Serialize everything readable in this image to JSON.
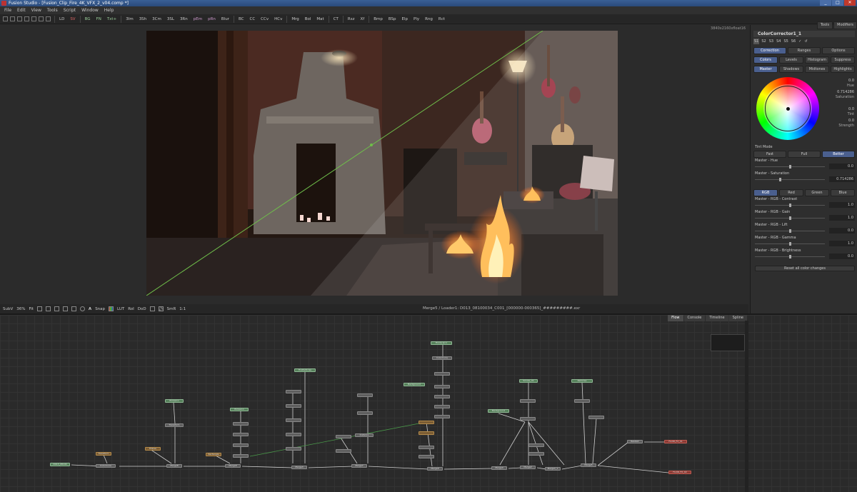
{
  "window": {
    "title": "Fusion Studio - [Fusion_Clip_Fire_4K_VFX_2_v04.comp *]",
    "controls": [
      "_",
      "□",
      "✕"
    ]
  },
  "menu": [
    "File",
    "Edit",
    "View",
    "Tools",
    "Script",
    "Window",
    "Help"
  ],
  "toolbar": [
    "LD",
    "SV",
    "BG",
    "FN",
    "Txt+",
    "3Im",
    "3Sh",
    "3Cm",
    "3SL",
    "3Rn",
    "pEm",
    "pRn",
    "Blur",
    "BC",
    "CC",
    "CCv",
    "HCv",
    "Mrg",
    "Bol",
    "Mat",
    "CT",
    "Rsz",
    "Xf",
    "Bmp",
    "BSp",
    "Elp",
    "Ply",
    "Rng",
    "Rct"
  ],
  "viewer": {
    "resolution": "3840x2160xfloat16",
    "toolbar": [
      "SubV",
      "36%",
      "Fit",
      "Snap",
      "LUT",
      "RoI",
      "DoD",
      "SmR",
      "1:1"
    ],
    "status": "Merge5 / Loader1: D013_08100034_C001_[000000-000365]_#########.exr"
  },
  "inspector": {
    "top_tabs": [
      "Tools",
      "Modifiers"
    ],
    "tool_name": "ColorCorrector1_1",
    "versions": [
      "S1",
      "S2",
      "S3",
      "S4",
      "S5",
      "S6"
    ],
    "tabs": [
      "Correction",
      "Ranges",
      "Options"
    ],
    "mode_tabs": [
      "Colors",
      "Levels",
      "Histogram",
      "Suppress"
    ],
    "range_tabs": [
      "Master",
      "Shadows",
      "Midtones",
      "Highlights"
    ],
    "wheel": {
      "hue": {
        "value": "0.0",
        "label": "Hue"
      },
      "saturation": {
        "value": "0.714286",
        "label": "Saturation"
      },
      "tint": {
        "value": "0.0",
        "label": "Tint"
      },
      "strength": {
        "value": "0.0",
        "label": "Strength"
      }
    },
    "tint_mode": {
      "label": "Tint Mode",
      "options": [
        "Fast",
        "Full",
        "Better"
      ],
      "selected": "Better"
    },
    "params_top": [
      {
        "label": "Master - Hue",
        "value": "0.0",
        "level": 0.5
      },
      {
        "label": "Master - Saturation",
        "value": "0.714286",
        "level": 0.36
      }
    ],
    "channel_tabs": [
      "RGB",
      "Red",
      "Green",
      "Blue"
    ],
    "params_rgb": [
      {
        "label": "Master - RGB - Contrast",
        "value": "1.0",
        "level": 0.5
      },
      {
        "label": "Master - RGB - Gain",
        "value": "1.0",
        "level": 0.5
      },
      {
        "label": "Master - RGB - Lift",
        "value": "0.0",
        "level": 0.5
      },
      {
        "label": "Master - RGB - Gamma",
        "value": "1.0",
        "level": 0.5
      },
      {
        "label": "Master - RGB - Brightness",
        "value": "0.0",
        "level": 0.5
      }
    ],
    "reset_label": "Reset all color changes"
  },
  "flow": {
    "tabs": [
      "Flow",
      "Console",
      "Timeline",
      "Spline"
    ],
    "nodes": [
      {
        "label": "D013_08100",
        "type": "green"
      },
      {
        "label": "ColorCorre",
        "type": "gray"
      },
      {
        "label": "Transform",
        "type": "orange"
      },
      {
        "label": "Merge8",
        "type": "gray"
      },
      {
        "label": "Ellipse",
        "type": "orange"
      },
      {
        "label": "Emission",
        "type": "green"
      },
      {
        "label": "Transform",
        "type": "gray"
      },
      {
        "label": "Merge6",
        "type": "gray"
      },
      {
        "label": "Rectangle",
        "type": "orange"
      },
      {
        "label": "Merge3",
        "type": "gray"
      },
      {
        "label": "Merge7",
        "type": "gray"
      },
      {
        "label": "Merge9",
        "type": "gray"
      },
      {
        "label": "Merge4",
        "type": "gray"
      },
      {
        "label": "Merge2",
        "type": "gray"
      },
      {
        "label": "Merge1_1",
        "type": "gray"
      },
      {
        "label": "Merge5",
        "type": "gray"
      },
      {
        "label": "Resize1",
        "type": "gray"
      },
      {
        "label": "FLUID_FX_01",
        "type": "red"
      },
      {
        "label": "FLUID_FX_02",
        "type": "red"
      },
      {
        "label": "Emission",
        "type": "green"
      },
      {
        "label": "FireParticles",
        "type": "green"
      },
      {
        "label": "Background",
        "type": "green"
      },
      {
        "label": "Smoke_01",
        "type": "green"
      },
      {
        "label": "Particles",
        "type": "green"
      },
      {
        "label": "Background",
        "type": "green"
      },
      {
        "label": "FilmGrain1",
        "type": "gray"
      },
      {
        "label": "ColorCorre",
        "type": "gray"
      },
      {
        "label": "Instance",
        "type": "gray"
      }
    ]
  }
}
